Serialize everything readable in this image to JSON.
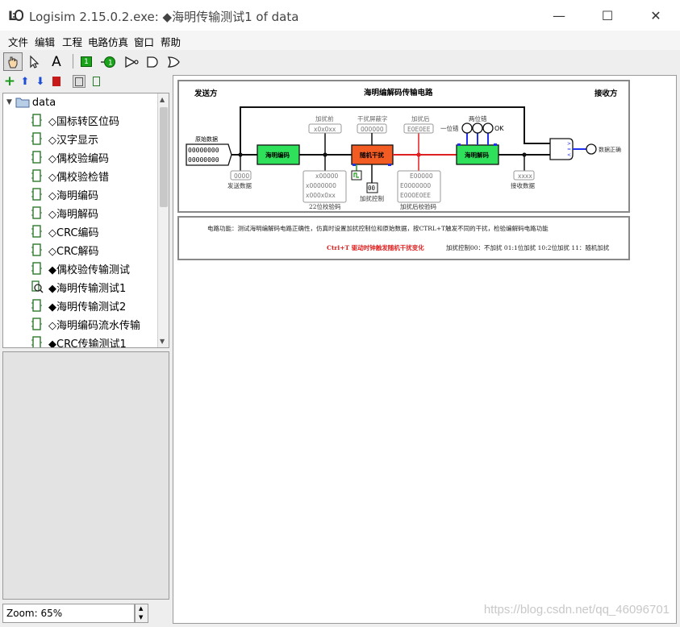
{
  "window": {
    "title": "Logisim 2.15.0.2.exe: ◆海明传输测试1 of data",
    "minimize": "—",
    "maximize": "☐",
    "close": "✕"
  },
  "menu": [
    "文件",
    "编辑",
    "工程",
    "电路仿真",
    "窗口",
    "帮助"
  ],
  "toolbar": {
    "tools": [
      "poke-tool-icon",
      "select-tool-icon",
      "text-tool-icon",
      "input-pin-icon",
      "output-pin-icon",
      "not-gate-icon",
      "and-gate-icon",
      "or-gate-icon"
    ],
    "input_pin_label": "1",
    "output_pin_label": "1",
    "text_tool_label": "A"
  },
  "project_tree": {
    "root": "data",
    "items": [
      {
        "label": "◇国标转区位码",
        "icon": "subcircuit-icon"
      },
      {
        "label": "◇汉字显示",
        "icon": "subcircuit-icon"
      },
      {
        "label": "◇偶校验编码",
        "icon": "subcircuit-icon"
      },
      {
        "label": "◇偶校验检错",
        "icon": "subcircuit-icon"
      },
      {
        "label": "◇海明编码",
        "icon": "subcircuit-icon"
      },
      {
        "label": "◇海明解码",
        "icon": "subcircuit-icon"
      },
      {
        "label": "◇CRC编码",
        "icon": "subcircuit-icon"
      },
      {
        "label": "◇CRC解码",
        "icon": "subcircuit-icon"
      },
      {
        "label": "◆偶校验传输测试",
        "icon": "subcircuit-icon"
      },
      {
        "label": "◆海明传输测试1",
        "icon": "magnifier-icon"
      },
      {
        "label": "◆海明传输测试2",
        "icon": "subcircuit-icon"
      },
      {
        "label": "◇海明编码流水传输",
        "icon": "subcircuit-icon"
      },
      {
        "label": "◆CRC传输测试1",
        "icon": "subcircuit-icon"
      }
    ]
  },
  "zoom": {
    "label": "Zoom: 65%"
  },
  "circuit": {
    "sender": "发送方",
    "title": "海明编解码传输电路",
    "receiver": "接收方",
    "input_label": "原始数据",
    "input_row1": "00000000",
    "input_row2": "00000000",
    "send_data_value": "0000",
    "send_data_label": "发送数据",
    "encoder": "海明编码",
    "before_noise_label": "加扰前",
    "before_noise_value": "x0x0xx",
    "noise_mask_label": "干扰屏蔽字",
    "noise_mask_value": "000000",
    "after_noise_label": "加扰后",
    "after_noise_value": "E0E0EE",
    "noise_block": "随机干扰",
    "parity22_rows": [
      "x00000",
      "x0000000",
      "x000x0xx"
    ],
    "parity22_label": "22位校验码",
    "noise_ctrl_value": "00",
    "noise_ctrl_label": "加扰控制",
    "after_parity_rows": [
      "E00000",
      "E0000000",
      "E000E0EE"
    ],
    "after_parity_label": "加扰后校验码",
    "decoder": "海明解码",
    "one_bit_err": "一位错",
    "two_bit_err": "两位错",
    "ok_label": "OK",
    "recv_data_value": "xxxx",
    "recv_data_label": "接收数据",
    "data_correct_label": "数据正确",
    "desc_line1": "电路功能：测试海明编解码电路正确性，仿真时设置加扰控制位和原始数据，按CTRL+T触发不同的干扰，检验编解码电路功能",
    "desc_hint": "Ctrl+T 驱动时钟触发随机干扰变化",
    "desc_ctrl": "加扰控制00：不加扰 01:1位加扰 10:2位加扰 11：随机加扰"
  },
  "watermark": "https://blog.csdn.net/qq_46096701",
  "colors": {
    "encoder": "#2fe05a",
    "noise": "#f25c22",
    "wire_red": "#e02020",
    "wire_blue": "#2030f0",
    "wire_green": "#1a9a1a"
  }
}
